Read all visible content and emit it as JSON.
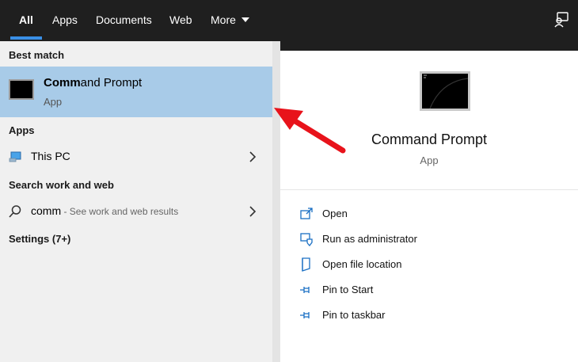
{
  "tabs": [
    {
      "label": "All"
    },
    {
      "label": "Apps"
    },
    {
      "label": "Documents"
    },
    {
      "label": "Web"
    },
    {
      "label": "More"
    }
  ],
  "left": {
    "best_match_header": "Best match",
    "best_match": {
      "title_bold": "Comm",
      "title_rest": "and Prompt",
      "subtitle": "App",
      "icon": "command-prompt-icon"
    },
    "apps_header": "Apps",
    "this_pc": {
      "label": "This PC",
      "icon": "computer-icon"
    },
    "search_header": "Search work and web",
    "web_search": {
      "query": "comm",
      "hint": " - See work and web results",
      "icon": "search-icon"
    },
    "settings_header": "Settings (7+)"
  },
  "right": {
    "app_name": "Command Prompt",
    "app_type": "App",
    "actions": [
      {
        "label": "Open",
        "icon": "open-icon"
      },
      {
        "label": "Run as administrator",
        "icon": "shield-icon"
      },
      {
        "label": "Open file location",
        "icon": "folder-icon"
      },
      {
        "label": "Pin to Start",
        "icon": "pin-icon"
      },
      {
        "label": "Pin to taskbar",
        "icon": "pin-icon"
      }
    ]
  },
  "colors": {
    "accent": "#3a8fe6",
    "highlight": "#a8cbe8",
    "arrow": "#e8131b",
    "action_icon": "#1a6fc4"
  }
}
